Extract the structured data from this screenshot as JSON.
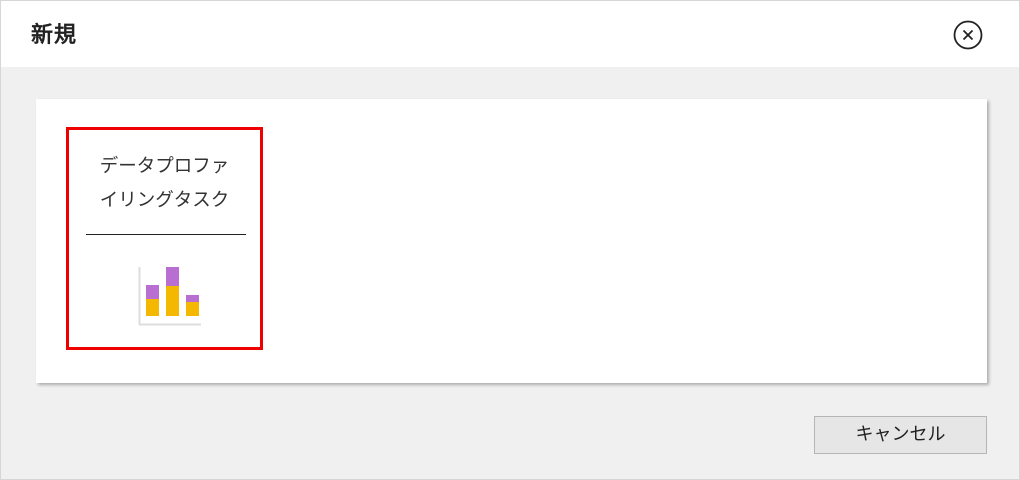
{
  "dialog": {
    "title": "新規",
    "close_icon": "close-circle-icon"
  },
  "tiles": [
    {
      "label": "データプロファ\nイリングタスク",
      "icon": "data-profiling-chart-icon",
      "selected": true
    }
  ],
  "footer": {
    "cancel_label": "キャンセル"
  },
  "colors": {
    "selection_border": "#ee0000",
    "icon_bar_top": "#b86fd1",
    "icon_bar_bottom": "#f5b800",
    "panel_background": "#ffffff",
    "dialog_background": "#f0f0f0"
  }
}
